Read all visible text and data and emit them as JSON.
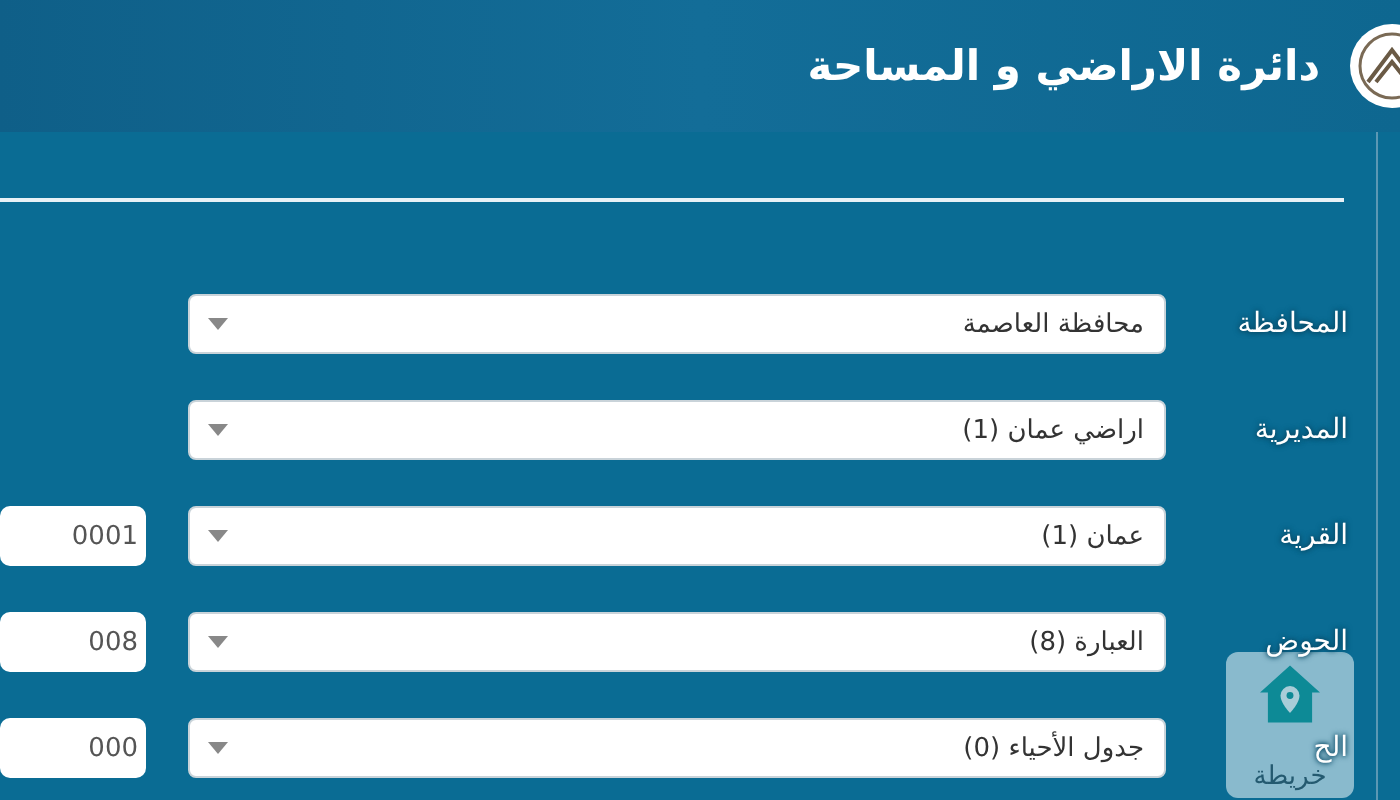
{
  "header": {
    "title": "دائرة الاراضي و المساحة"
  },
  "fields": [
    {
      "label": "المحافظة",
      "value": "محافظة العاصمة"
    },
    {
      "label": "المديرية",
      "value": "اراضي عمان (1)"
    },
    {
      "label": "القرية",
      "value": "عمان (1)",
      "code": "0001"
    },
    {
      "label": "الحوض",
      "value": "العبارة (8)",
      "code": "008"
    },
    {
      "label": "الح",
      "value": "جدول الأحياء (0)",
      "code": "000"
    }
  ],
  "map_button": {
    "label": "خريطة"
  }
}
